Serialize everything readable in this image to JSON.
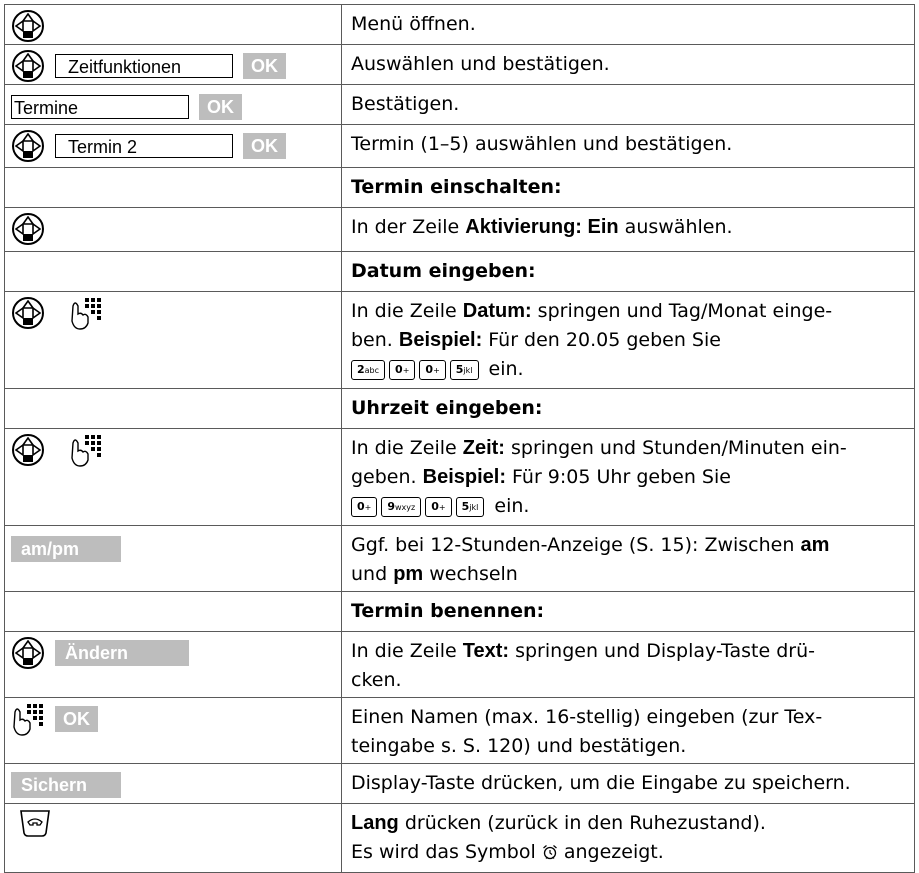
{
  "rows": [
    {
      "text": "Menü öffnen."
    },
    {
      "field": "Zeitfunktionen",
      "ok": "OK",
      "text": "Auswählen und bestätigen."
    },
    {
      "field": "Termine",
      "ok": "OK",
      "text": "Bestätigen."
    },
    {
      "field": "Termin 2",
      "ok": "OK",
      "text": "Termin (1–5) auswählen und bestätigen."
    },
    {
      "text": "Termin einschalten:"
    },
    {
      "pre": "In der Zeile ",
      "bold": "Aktivierung: Ein",
      "post": " auswählen."
    },
    {
      "text": "Datum eingeben:"
    },
    {
      "pre": "In die Zeile ",
      "bold": "Datum:",
      "post": " springen und Tag/Monat einge-",
      "line2a": "ben. ",
      "bold2": "Beispiel:",
      "line2b": " Für den 20.05 geben Sie",
      "suffix": "ein."
    },
    {
      "text": "Uhrzeit eingeben:"
    },
    {
      "pre": "In die Zeile ",
      "bold": "Zeit:",
      "post": " springen und Stunden/Minuten ein-",
      "line2a": "geben. ",
      "bold2": "Beispiel:",
      "line2b": " Für 9:05 Uhr geben Sie",
      "suffix": "ein."
    },
    {
      "softkey": "am/pm",
      "line1": "Ggf. bei 12-Stunden-Anzeige (S. 15): Zwischen ",
      "bold1": "am",
      "line2pre": "und ",
      "bold2": "pm",
      "line2post": " wechseln"
    },
    {
      "text": "Termin benennen:"
    },
    {
      "softkey": "Ändern",
      "pre": "In die Zeile ",
      "bold": "Text:",
      "post": " springen und Display-Taste drü-",
      "line2": "cken."
    },
    {
      "ok": "OK",
      "line1": "Einen Namen (max. 16-stellig) eingeben (zur Tex-",
      "line2": "teingabe s. S. 120) und bestätigen."
    },
    {
      "softkey": "Sichern",
      "text": "Display-Taste drücken, um die Eingabe zu speichern."
    },
    {
      "bold": "Lang",
      "post": " drücken (zurück in den Ruhezustand).",
      "line2pre": "Es wird das Symbol ",
      "line2post": " angezeigt."
    }
  ],
  "keys_date": [
    {
      "digit": "2",
      "letters": "abc"
    },
    {
      "digit": "0",
      "letters": "+"
    },
    {
      "digit": "0",
      "letters": "+"
    },
    {
      "digit": "5",
      "letters": "jkl"
    }
  ],
  "keys_time": [
    {
      "digit": "0",
      "letters": "+"
    },
    {
      "digit": "9",
      "letters": "wxyz"
    },
    {
      "digit": "0",
      "letters": "+"
    },
    {
      "digit": "5",
      "letters": "jkl"
    }
  ],
  "colors": {
    "softkey_bg": "#bdbdbd",
    "border": "#5a5a5a"
  }
}
